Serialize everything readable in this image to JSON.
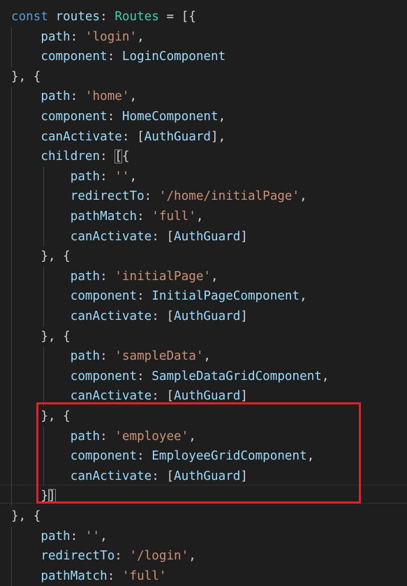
{
  "code_lines": [
    [
      {
        "t": "const ",
        "c": "kw"
      },
      {
        "t": "routes",
        "c": "var"
      },
      {
        "t": ": ",
        "c": "plain"
      },
      {
        "t": "Routes",
        "c": "type"
      },
      {
        "t": " = [{",
        "c": "plain"
      }
    ],
    [
      {
        "t": "    path",
        "c": "var"
      },
      {
        "t": ": ",
        "c": "plain"
      },
      {
        "t": "'login'",
        "c": "str"
      },
      {
        "t": ",",
        "c": "plain"
      }
    ],
    [
      {
        "t": "    component",
        "c": "var"
      },
      {
        "t": ": ",
        "c": "plain"
      },
      {
        "t": "LoginComponent",
        "c": "var"
      }
    ],
    [
      {
        "t": "}, {",
        "c": "plain"
      }
    ],
    [
      {
        "t": "    path",
        "c": "var"
      },
      {
        "t": ": ",
        "c": "plain"
      },
      {
        "t": "'home'",
        "c": "str"
      },
      {
        "t": ",",
        "c": "plain"
      }
    ],
    [
      {
        "t": "    component",
        "c": "var"
      },
      {
        "t": ": ",
        "c": "plain"
      },
      {
        "t": "HomeComponent",
        "c": "var"
      },
      {
        "t": ",",
        "c": "plain"
      }
    ],
    [
      {
        "t": "    canActivate",
        "c": "var"
      },
      {
        "t": ": [",
        "c": "plain"
      },
      {
        "t": "AuthGuard",
        "c": "var"
      },
      {
        "t": "],",
        "c": "plain"
      }
    ],
    [
      {
        "t": "    children",
        "c": "var"
      },
      {
        "t": ": ",
        "c": "plain"
      },
      {
        "t": "[",
        "c": "plain",
        "m": true
      },
      {
        "t": "{",
        "c": "plain"
      }
    ],
    [
      {
        "t": "        path",
        "c": "var"
      },
      {
        "t": ": ",
        "c": "plain"
      },
      {
        "t": "''",
        "c": "str"
      },
      {
        "t": ",",
        "c": "plain"
      }
    ],
    [
      {
        "t": "        redirectTo",
        "c": "var"
      },
      {
        "t": ": ",
        "c": "plain"
      },
      {
        "t": "'/home/initialPage'",
        "c": "str"
      },
      {
        "t": ",",
        "c": "plain"
      }
    ],
    [
      {
        "t": "        pathMatch",
        "c": "var"
      },
      {
        "t": ": ",
        "c": "plain"
      },
      {
        "t": "'full'",
        "c": "str"
      },
      {
        "t": ",",
        "c": "plain"
      }
    ],
    [
      {
        "t": "        canActivate",
        "c": "var"
      },
      {
        "t": ": [",
        "c": "plain"
      },
      {
        "t": "AuthGuard",
        "c": "var"
      },
      {
        "t": "]",
        "c": "plain"
      }
    ],
    [
      {
        "t": "    }, {",
        "c": "plain"
      }
    ],
    [
      {
        "t": "        path",
        "c": "var"
      },
      {
        "t": ": ",
        "c": "plain"
      },
      {
        "t": "'initialPage'",
        "c": "str"
      },
      {
        "t": ",",
        "c": "plain"
      }
    ],
    [
      {
        "t": "        component",
        "c": "var"
      },
      {
        "t": ": ",
        "c": "plain"
      },
      {
        "t": "InitialPageComponent",
        "c": "var"
      },
      {
        "t": ",",
        "c": "plain"
      }
    ],
    [
      {
        "t": "        canActivate",
        "c": "var"
      },
      {
        "t": ": [",
        "c": "plain"
      },
      {
        "t": "AuthGuard",
        "c": "var"
      },
      {
        "t": "]",
        "c": "plain"
      }
    ],
    [
      {
        "t": "    }, {",
        "c": "plain"
      }
    ],
    [
      {
        "t": "        path",
        "c": "var"
      },
      {
        "t": ": ",
        "c": "plain"
      },
      {
        "t": "'sampleData'",
        "c": "str"
      },
      {
        "t": ",",
        "c": "plain"
      }
    ],
    [
      {
        "t": "        component",
        "c": "var"
      },
      {
        "t": ": ",
        "c": "plain"
      },
      {
        "t": "SampleDataGridComponent",
        "c": "var"
      },
      {
        "t": ",",
        "c": "plain"
      }
    ],
    [
      {
        "t": "        canActivate",
        "c": "var"
      },
      {
        "t": ": [",
        "c": "plain"
      },
      {
        "t": "AuthGuard",
        "c": "var"
      },
      {
        "t": "]",
        "c": "plain"
      }
    ],
    [
      {
        "t": "    }, {",
        "c": "plain"
      }
    ],
    [
      {
        "t": "        path",
        "c": "var"
      },
      {
        "t": ": ",
        "c": "plain"
      },
      {
        "t": "'employee'",
        "c": "str"
      },
      {
        "t": ",",
        "c": "plain"
      }
    ],
    [
      {
        "t": "        component",
        "c": "var"
      },
      {
        "t": ": ",
        "c": "plain"
      },
      {
        "t": "EmployeeGridComponent",
        "c": "var"
      },
      {
        "t": ",",
        "c": "plain"
      }
    ],
    [
      {
        "t": "        canActivate",
        "c": "var"
      },
      {
        "t": ": [",
        "c": "plain"
      },
      {
        "t": "AuthGuard",
        "c": "var"
      },
      {
        "t": "]",
        "c": "plain"
      }
    ],
    [
      {
        "t": "    }",
        "c": "plain"
      },
      {
        "t": "]",
        "c": "plain",
        "m": true,
        "cur": true
      }
    ],
    [
      {
        "t": "}, {",
        "c": "plain"
      }
    ],
    [
      {
        "t": "    path",
        "c": "var"
      },
      {
        "t": ": ",
        "c": "plain"
      },
      {
        "t": "''",
        "c": "str"
      },
      {
        "t": ",",
        "c": "plain"
      }
    ],
    [
      {
        "t": "    redirectTo",
        "c": "var"
      },
      {
        "t": ": ",
        "c": "plain"
      },
      {
        "t": "'/login'",
        "c": "str"
      },
      {
        "t": ",",
        "c": "plain"
      }
    ],
    [
      {
        "t": "    pathMatch",
        "c": "var"
      },
      {
        "t": ": ",
        "c": "plain"
      },
      {
        "t": "'full'",
        "c": "str"
      }
    ]
  ],
  "colors": {
    "background": "#1e1e1e",
    "keyword": "#569cd6",
    "variable": "#9cdcfe",
    "type": "#4ec9b0",
    "string": "#ce9178",
    "punctuation": "#d4d4d4",
    "annotation_box": "#e0202a"
  }
}
